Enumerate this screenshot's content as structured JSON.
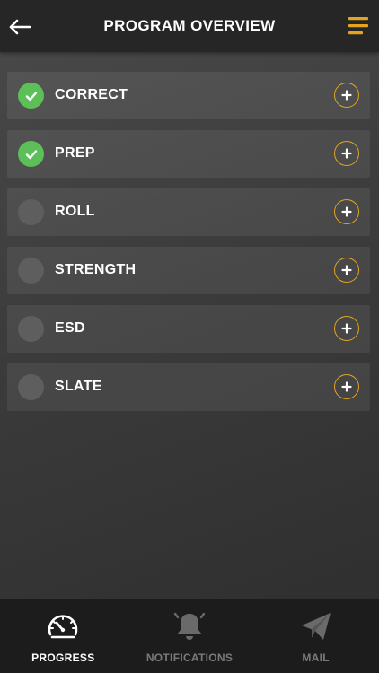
{
  "header": {
    "title": "PROGRAM OVERVIEW",
    "back_icon": "arrow-left-icon",
    "menu_icon": "hamburger-menu-icon"
  },
  "colors": {
    "accent": "#e3a51f",
    "complete": "#5cbf57",
    "incomplete": "#5e5e5e"
  },
  "items": [
    {
      "label": "CORRECT",
      "completed": true
    },
    {
      "label": "PREP",
      "completed": true
    },
    {
      "label": "ROLL",
      "completed": false
    },
    {
      "label": "STRENGTH",
      "completed": false
    },
    {
      "label": "ESD",
      "completed": false
    },
    {
      "label": "SLATE",
      "completed": false
    }
  ],
  "tabs": [
    {
      "label": "PROGRESS",
      "icon": "speedometer-icon",
      "active": true
    },
    {
      "label": "NOTIFICATIONS",
      "icon": "bell-icon",
      "active": false
    },
    {
      "label": "MAIL",
      "icon": "paper-plane-icon",
      "active": false
    }
  ]
}
